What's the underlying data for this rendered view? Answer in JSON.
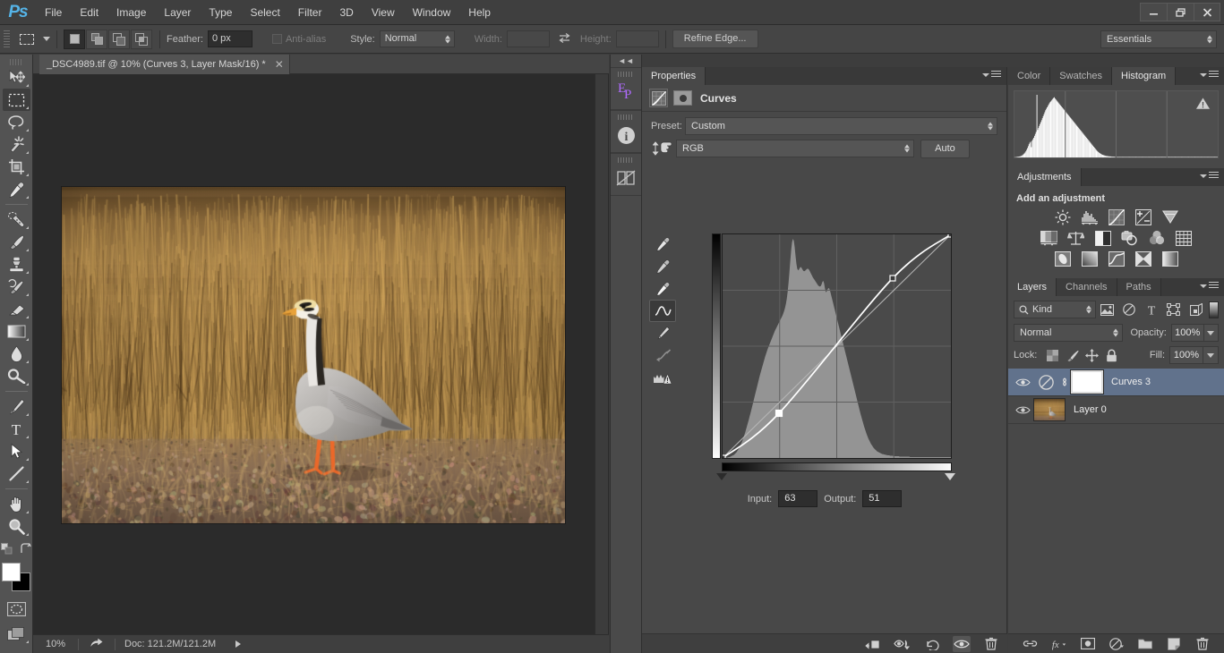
{
  "app": {
    "logo": "Ps",
    "menus": [
      "File",
      "Edit",
      "Image",
      "Layer",
      "Type",
      "Select",
      "Filter",
      "3D",
      "View",
      "Window",
      "Help"
    ],
    "window_buttons": [
      "minimize",
      "restore",
      "close"
    ]
  },
  "options_bar": {
    "tool_icon": "rectangular-marquee-icon",
    "selection_modes": [
      "new-selection",
      "add-to-selection",
      "subtract-from-selection",
      "intersect-with-selection"
    ],
    "active_selection_mode": 0,
    "feather_label": "Feather:",
    "feather_value": "0 px",
    "antialias_label": "Anti-alias",
    "antialias_checked": false,
    "style_label": "Style:",
    "style_value": "Normal",
    "width_label": "Width:",
    "width_value": "",
    "height_label": "Height:",
    "height_value": "",
    "swap_icon": "swap-arrows-icon",
    "refine_edge_label": "Refine Edge...",
    "workspace_value": "Essentials"
  },
  "toolbox": {
    "tools": [
      "move-icon",
      "rectangular-marquee-icon",
      "lasso-icon",
      "magic-wand-icon",
      "crop-icon",
      "eyedropper-icon",
      "spot-healing-brush-icon",
      "brush-icon",
      "clone-stamp-icon",
      "history-brush-icon",
      "eraser-icon",
      "gradient-icon",
      "blur-icon",
      "dodge-icon",
      "pen-icon",
      "type-icon",
      "path-selection-icon",
      "line-shape-icon",
      "hand-icon",
      "zoom-icon"
    ],
    "active_tool": "rectangular-marquee-icon",
    "foreground_color": "#ffffff",
    "background_color": "#000000",
    "quick_mask_icon": "quick-mask-icon",
    "screen_mode_icon": "screen-mode-icon"
  },
  "document": {
    "tab_title": "_DSC4989.tif @ 10% (Curves 3, Layer Mask/16) *",
    "close_icon": "close-icon"
  },
  "status_bar": {
    "zoom": "10%",
    "share_icon": "share-icon",
    "doc_info": "Doc: 121.2M/121.2M",
    "expand_icon": "play-arrow-icon"
  },
  "mini_dock": {
    "collapse_icon": "collapse-arrows-icon",
    "items": [
      "extensions-panel-icon",
      "info-panel-icon",
      "notes-panel-icon"
    ]
  },
  "properties": {
    "tabs": [
      {
        "label": "Properties",
        "active": true
      }
    ],
    "panel_menu_icon": "panel-menu-icon",
    "header_title": "Curves",
    "header_icons": [
      "curves-adjustment-icon",
      "layer-mask-icon"
    ],
    "preset_label": "Preset:",
    "preset_value": "Custom",
    "channel_icon": "on-image-adjust-icon",
    "channel_value": "RGB",
    "auto_label": "Auto",
    "curve_tools": [
      "black-point-eyedropper-icon",
      "gray-point-eyedropper-icon",
      "white-point-eyedropper-icon",
      "curve-point-tool-icon",
      "pencil-draw-curve-icon",
      "smooth-curve-icon",
      "clipping-warning-icon"
    ],
    "active_curve_tool": 3,
    "input_label": "Input:",
    "input_value": "63",
    "output_label": "Output:",
    "output_value": "51",
    "black_slider": 0,
    "white_slider": 255,
    "footer_icons": [
      "clip-to-layer-icon",
      "toggle-visibility-icon",
      "reset-icon",
      "view-previous-icon",
      "delete-icon"
    ]
  },
  "color_panel": {
    "tabs": [
      {
        "label": "Color",
        "active": false
      },
      {
        "label": "Swatches",
        "active": false
      },
      {
        "label": "Histogram",
        "active": true
      }
    ],
    "panel_menu_icon": "panel-menu-icon",
    "warning_icon": "cached-data-warning-icon"
  },
  "adjustments": {
    "tabs": [
      {
        "label": "Adjustments",
        "active": true
      }
    ],
    "panel_menu_icon": "panel-menu-icon",
    "title": "Add an adjustment",
    "icons_row1": [
      "brightness-contrast-icon",
      "levels-icon",
      "curves-icon",
      "exposure-icon",
      "vibrance-icon"
    ],
    "icons_row2": [
      "hue-saturation-icon",
      "color-balance-icon",
      "black-white-icon",
      "photo-filter-icon",
      "channel-mixer-icon",
      "color-lookup-icon"
    ],
    "icons_row3": [
      "invert-icon",
      "posterize-icon",
      "threshold-icon",
      "gradient-map-icon",
      "selective-color-icon"
    ]
  },
  "layers": {
    "tabs": [
      {
        "label": "Layers",
        "active": true
      },
      {
        "label": "Channels",
        "active": false
      },
      {
        "label": "Paths",
        "active": false
      }
    ],
    "panel_menu_icon": "panel-menu-icon",
    "filter_label": "Kind",
    "filter_search_icon": "search-icon",
    "filter_icons": [
      "pixel-layer-filter-icon",
      "adjustment-layer-filter-icon",
      "type-layer-filter-icon",
      "shape-layer-filter-icon",
      "smart-object-filter-icon"
    ],
    "filter_toggle_icon": "filter-toggle-icon",
    "blend_mode": "Normal",
    "opacity_label": "Opacity:",
    "opacity_value": "100%",
    "lock_label": "Lock:",
    "lock_icons": [
      "lock-transparency-icon",
      "lock-image-icon",
      "lock-position-icon",
      "lock-all-icon"
    ],
    "fill_label": "Fill:",
    "fill_value": "100%",
    "items": [
      {
        "name": "Curves 3",
        "visible": true,
        "selected": true,
        "type": "adjustment",
        "thumb_icon": "curves-adjustment-thumb-icon",
        "link_icon": "mask-link-icon",
        "has_mask": true
      },
      {
        "name": "Layer 0",
        "visible": true,
        "selected": false,
        "type": "pixel",
        "has_mask": false
      }
    ],
    "footer_icons": [
      "link-layers-icon",
      "layer-style-icon",
      "add-mask-icon",
      "new-adjustment-icon",
      "new-group-icon",
      "new-layer-icon",
      "delete-layer-icon"
    ]
  },
  "chart_data": {
    "type": "line",
    "title": "Curves (RGB)",
    "xlabel": "Input",
    "ylabel": "Output",
    "xlim": [
      0,
      255
    ],
    "ylim": [
      0,
      255
    ],
    "grid": true,
    "grid_divisions": 4,
    "control_points": [
      {
        "input": 0,
        "output": 0,
        "selected": false
      },
      {
        "input": 63,
        "output": 51,
        "selected": true
      },
      {
        "input": 190,
        "output": 205,
        "selected": false
      },
      {
        "input": 255,
        "output": 255,
        "selected": false
      }
    ],
    "baseline": {
      "from": [
        0,
        0
      ],
      "to": [
        255,
        255
      ]
    },
    "histogram_overlay": [
      0,
      0,
      0,
      0,
      0,
      1,
      1,
      2,
      2,
      3,
      4,
      5,
      6,
      7,
      9,
      11,
      13,
      16,
      19,
      22,
      26,
      30,
      35,
      40,
      46,
      52,
      58,
      65,
      72,
      79,
      86,
      94,
      101,
      109,
      117,
      125,
      133,
      141,
      149,
      157,
      165,
      173,
      181,
      189,
      196,
      203,
      210,
      217,
      224,
      231,
      237,
      243,
      249,
      254,
      259,
      264,
      269,
      274,
      279,
      284,
      289,
      293,
      297,
      301,
      305,
      309,
      313,
      317,
      321,
      325,
      330,
      336,
      343,
      352,
      364,
      380,
      400,
      424,
      450,
      474,
      492,
      500,
      496,
      482,
      462,
      444,
      432,
      428,
      430,
      434,
      436,
      434,
      430,
      427,
      426,
      427,
      429,
      431,
      432,
      431,
      428,
      424,
      420,
      416,
      412,
      409,
      406,
      403,
      400,
      397,
      394,
      392,
      391,
      392,
      396,
      402,
      404,
      398,
      386,
      378,
      380,
      385,
      388,
      386,
      380,
      372,
      364,
      356,
      348,
      340,
      332,
      324,
      316,
      308,
      300,
      292,
      284,
      276,
      268,
      260,
      252,
      244,
      236,
      228,
      220,
      212,
      204,
      196,
      188,
      180,
      172,
      164,
      156,
      148,
      140,
      132,
      124,
      116,
      108,
      100,
      93,
      86,
      79,
      72,
      66,
      60,
      54,
      49,
      44,
      40,
      36,
      32,
      29,
      26,
      23,
      21,
      19,
      17,
      15,
      14,
      13,
      12,
      11,
      10,
      9,
      9,
      8,
      8,
      7,
      7,
      6,
      6,
      6,
      5,
      5,
      5,
      5,
      4,
      4,
      4,
      4,
      4,
      4,
      4,
      3,
      3,
      3,
      3,
      3,
      3,
      3,
      3,
      3,
      3,
      3,
      3,
      2,
      2,
      2,
      2,
      2,
      2,
      2,
      2,
      2,
      2,
      2,
      2,
      2,
      2,
      2,
      2,
      2,
      2,
      2,
      2,
      2,
      2,
      2,
      2,
      2,
      2,
      2,
      2,
      2,
      2,
      2,
      2,
      2,
      2,
      2,
      2,
      2,
      2,
      2,
      2,
      2,
      2,
      2,
      2,
      2,
      2,
      2,
      2
    ],
    "histogram_panel": [
      1,
      1,
      2,
      2,
      3,
      3,
      4,
      5,
      6,
      8,
      10,
      13,
      16,
      20,
      25,
      31,
      38,
      46,
      54,
      60,
      64,
      42,
      68,
      74,
      80,
      88,
      96,
      104,
      255,
      112,
      120,
      128,
      136,
      144,
      152,
      160,
      168,
      176,
      184,
      192,
      198,
      204,
      210,
      216,
      221,
      226,
      230,
      234,
      238,
      242,
      245,
      240,
      236,
      232,
      228,
      224,
      220,
      216,
      212,
      208,
      204,
      200,
      196,
      192,
      188,
      184,
      180,
      176,
      172,
      168,
      164,
      160,
      156,
      152,
      148,
      144,
      140,
      136,
      132,
      128,
      124,
      120,
      116,
      112,
      108,
      104,
      100,
      96,
      92,
      88,
      84,
      80,
      76,
      72,
      68,
      64,
      60,
      56,
      52,
      48,
      44,
      40,
      36,
      32,
      28,
      25,
      22,
      19,
      17,
      15,
      13,
      11,
      10,
      9,
      8,
      7,
      6,
      6,
      5,
      5,
      4,
      4,
      4,
      3,
      3,
      3,
      3,
      2,
      2,
      2,
      2,
      2,
      2,
      2,
      2,
      2,
      2,
      2,
      2,
      2,
      2,
      2,
      2,
      2,
      2,
      2,
      2,
      2,
      2,
      2,
      2,
      2,
      2,
      2,
      2,
      2,
      2,
      2,
      2,
      2,
      2,
      2,
      2,
      2,
      2,
      2,
      2,
      2,
      2,
      2,
      2,
      2,
      2,
      2,
      2,
      2,
      2,
      2,
      2,
      2,
      2,
      2,
      2,
      2,
      2,
      2,
      2,
      2,
      2,
      2,
      2,
      2,
      2,
      2,
      2,
      2,
      2,
      2,
      2,
      2,
      2,
      2,
      2,
      2,
      2,
      2,
      2,
      2,
      2,
      2,
      2,
      2,
      2,
      2,
      2,
      2,
      2,
      2,
      2,
      2,
      2,
      2,
      2,
      2,
      2,
      2,
      2,
      2,
      2,
      2,
      2,
      2,
      2,
      2,
      2,
      2,
      2,
      2,
      2,
      2,
      2,
      2,
      2,
      2,
      2,
      2,
      2,
      2,
      2,
      2,
      2,
      2,
      2,
      2,
      2,
      2,
      2,
      2
    ]
  },
  "image": {
    "subject": "bar-headed-goose-in-dry-grass",
    "palette": {
      "grass_light": "#c49a5e",
      "grass_mid": "#9d7740",
      "grass_dark": "#6b4f2a",
      "ground": "#8a7158",
      "bird_body": "#b4b2b0",
      "bird_beak": "#e8a23a",
      "bird_legs": "#f06a2a"
    }
  }
}
